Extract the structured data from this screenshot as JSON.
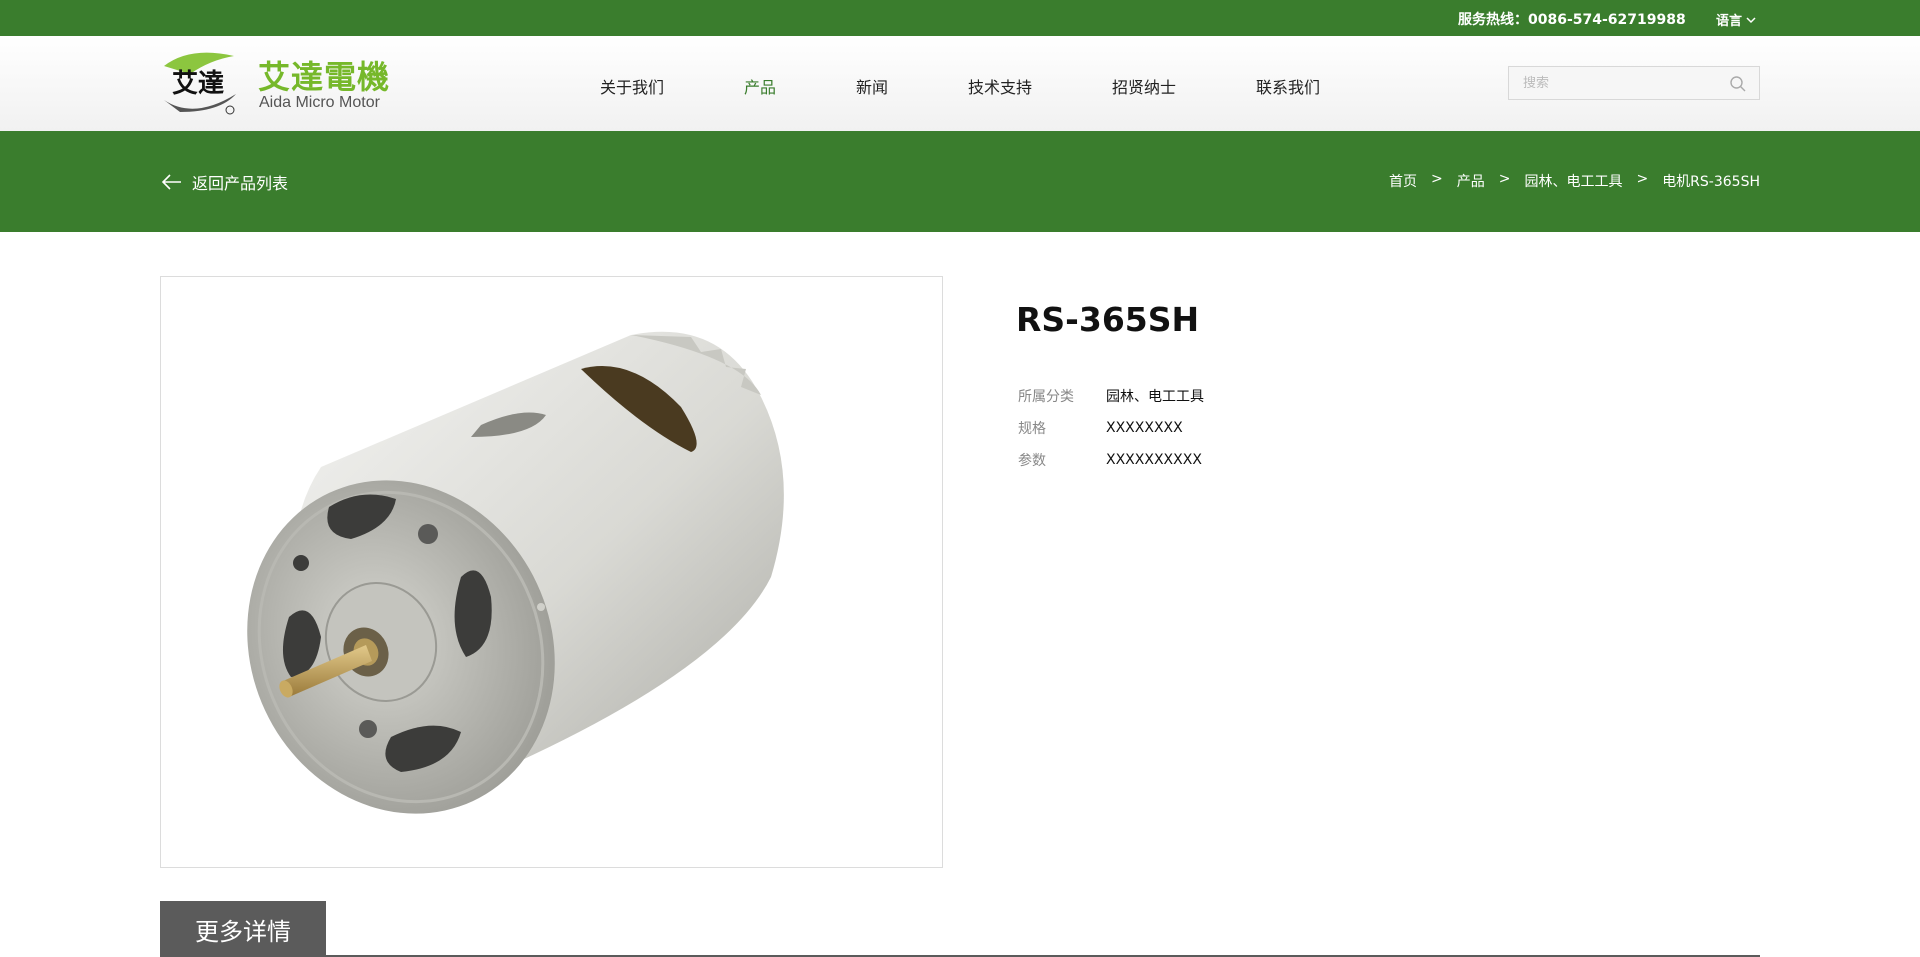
{
  "topbar": {
    "hotline": "服务热线：0086-574-62719988",
    "language_label": "语言"
  },
  "header": {
    "logo_badge_text": "艾達",
    "logo_cn": "艾達電機",
    "logo_en": "Aida Micro Motor",
    "nav": [
      {
        "label": "关于我们",
        "active": false
      },
      {
        "label": "产品",
        "active": true
      },
      {
        "label": "新闻",
        "active": false
      },
      {
        "label": "技术支持",
        "active": false
      },
      {
        "label": "招贤纳士",
        "active": false
      },
      {
        "label": "联系我们",
        "active": false
      }
    ],
    "search_placeholder": "搜索"
  },
  "banner": {
    "back_label": "返回产品列表",
    "breadcrumb": [
      "首页",
      "产品",
      "园林、电工工具",
      "电机RS-365SH"
    ],
    "separator": ">"
  },
  "product": {
    "title": "RS-365SH",
    "specs": [
      {
        "label": "所属分类",
        "value": "园林、电工工具"
      },
      {
        "label": "规格",
        "value": "XXXXXXXX"
      },
      {
        "label": "参数",
        "value": "XXXXXXXXXX"
      }
    ],
    "more_details_label": "更多详情"
  },
  "colors": {
    "brand_green": "#3a7d2d",
    "logo_green": "#76b82a",
    "tab_gray": "#5b5b5b"
  }
}
